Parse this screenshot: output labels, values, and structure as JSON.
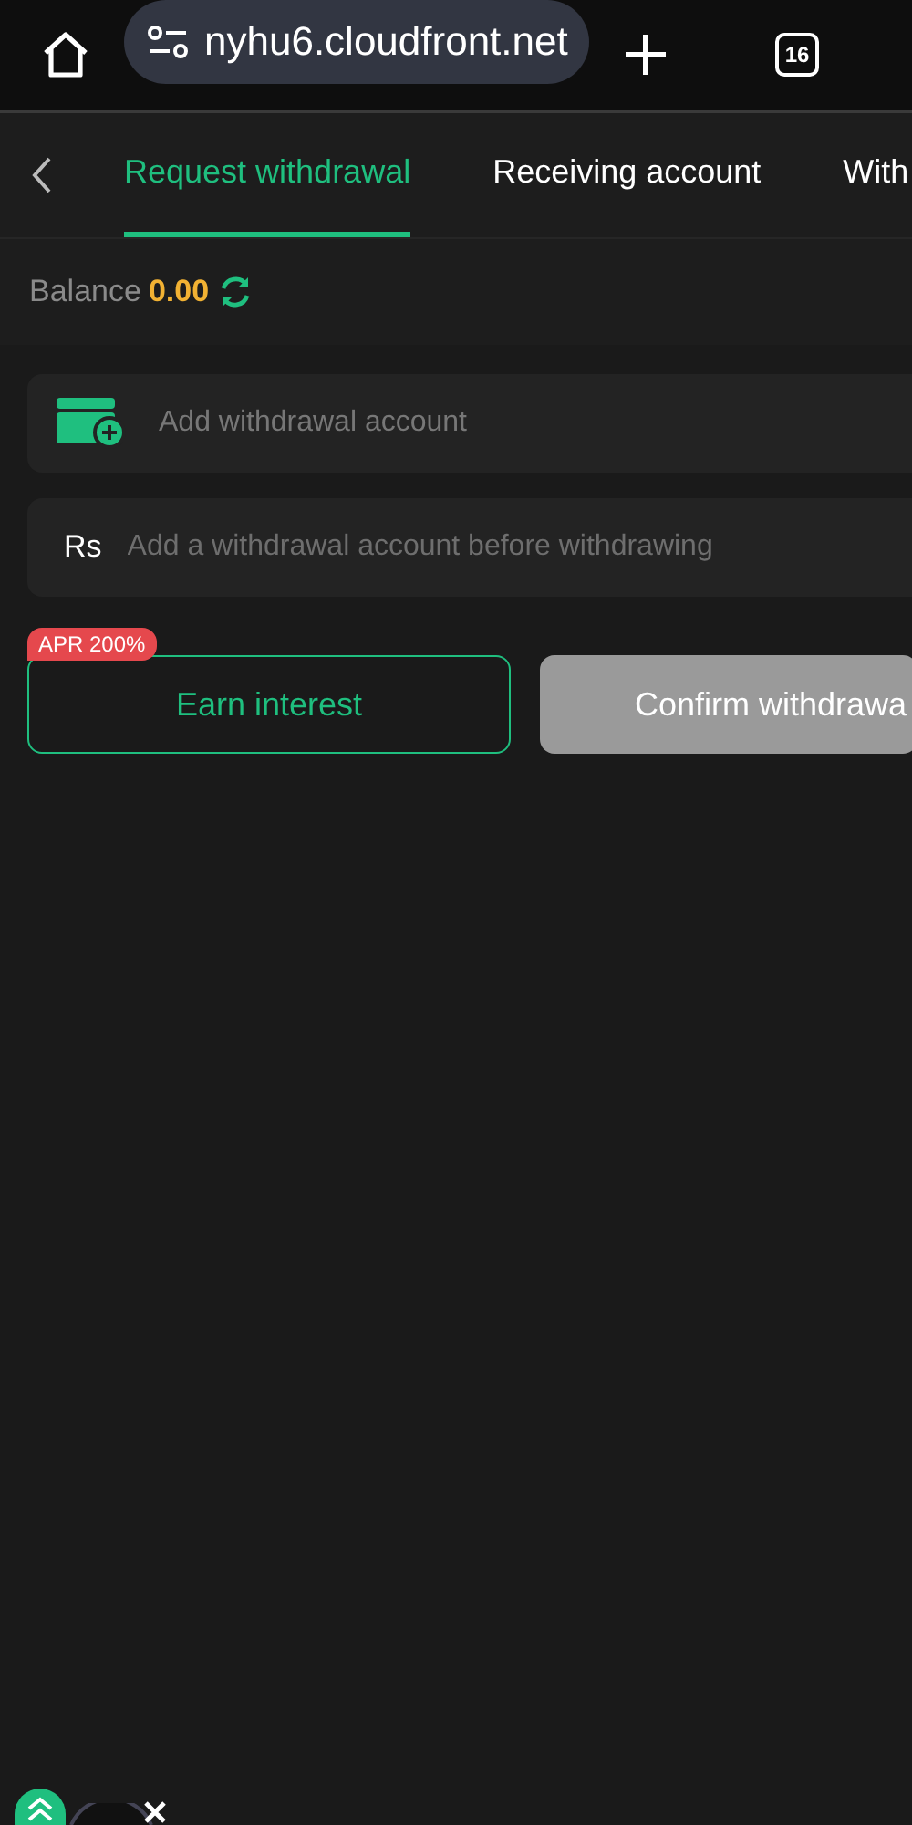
{
  "browser": {
    "url": "nyhu6.cloudfront.net",
    "tab_count": "16"
  },
  "tabs": [
    {
      "label": "Request withdrawal",
      "selected": true
    },
    {
      "label": "Receiving account",
      "selected": false
    },
    {
      "label": "With",
      "selected": false
    }
  ],
  "balance": {
    "label": "Balance",
    "value": "0.00"
  },
  "add_account": {
    "label": "Add withdrawal account"
  },
  "amount_field": {
    "prefix": "Rs",
    "placeholder": "Add a withdrawal account before withdrawing"
  },
  "earn_button": {
    "label": "Earn interest",
    "badge": "APR 200%"
  },
  "confirm_button": {
    "label": "Confirm withdrawa",
    "disabled": true
  }
}
